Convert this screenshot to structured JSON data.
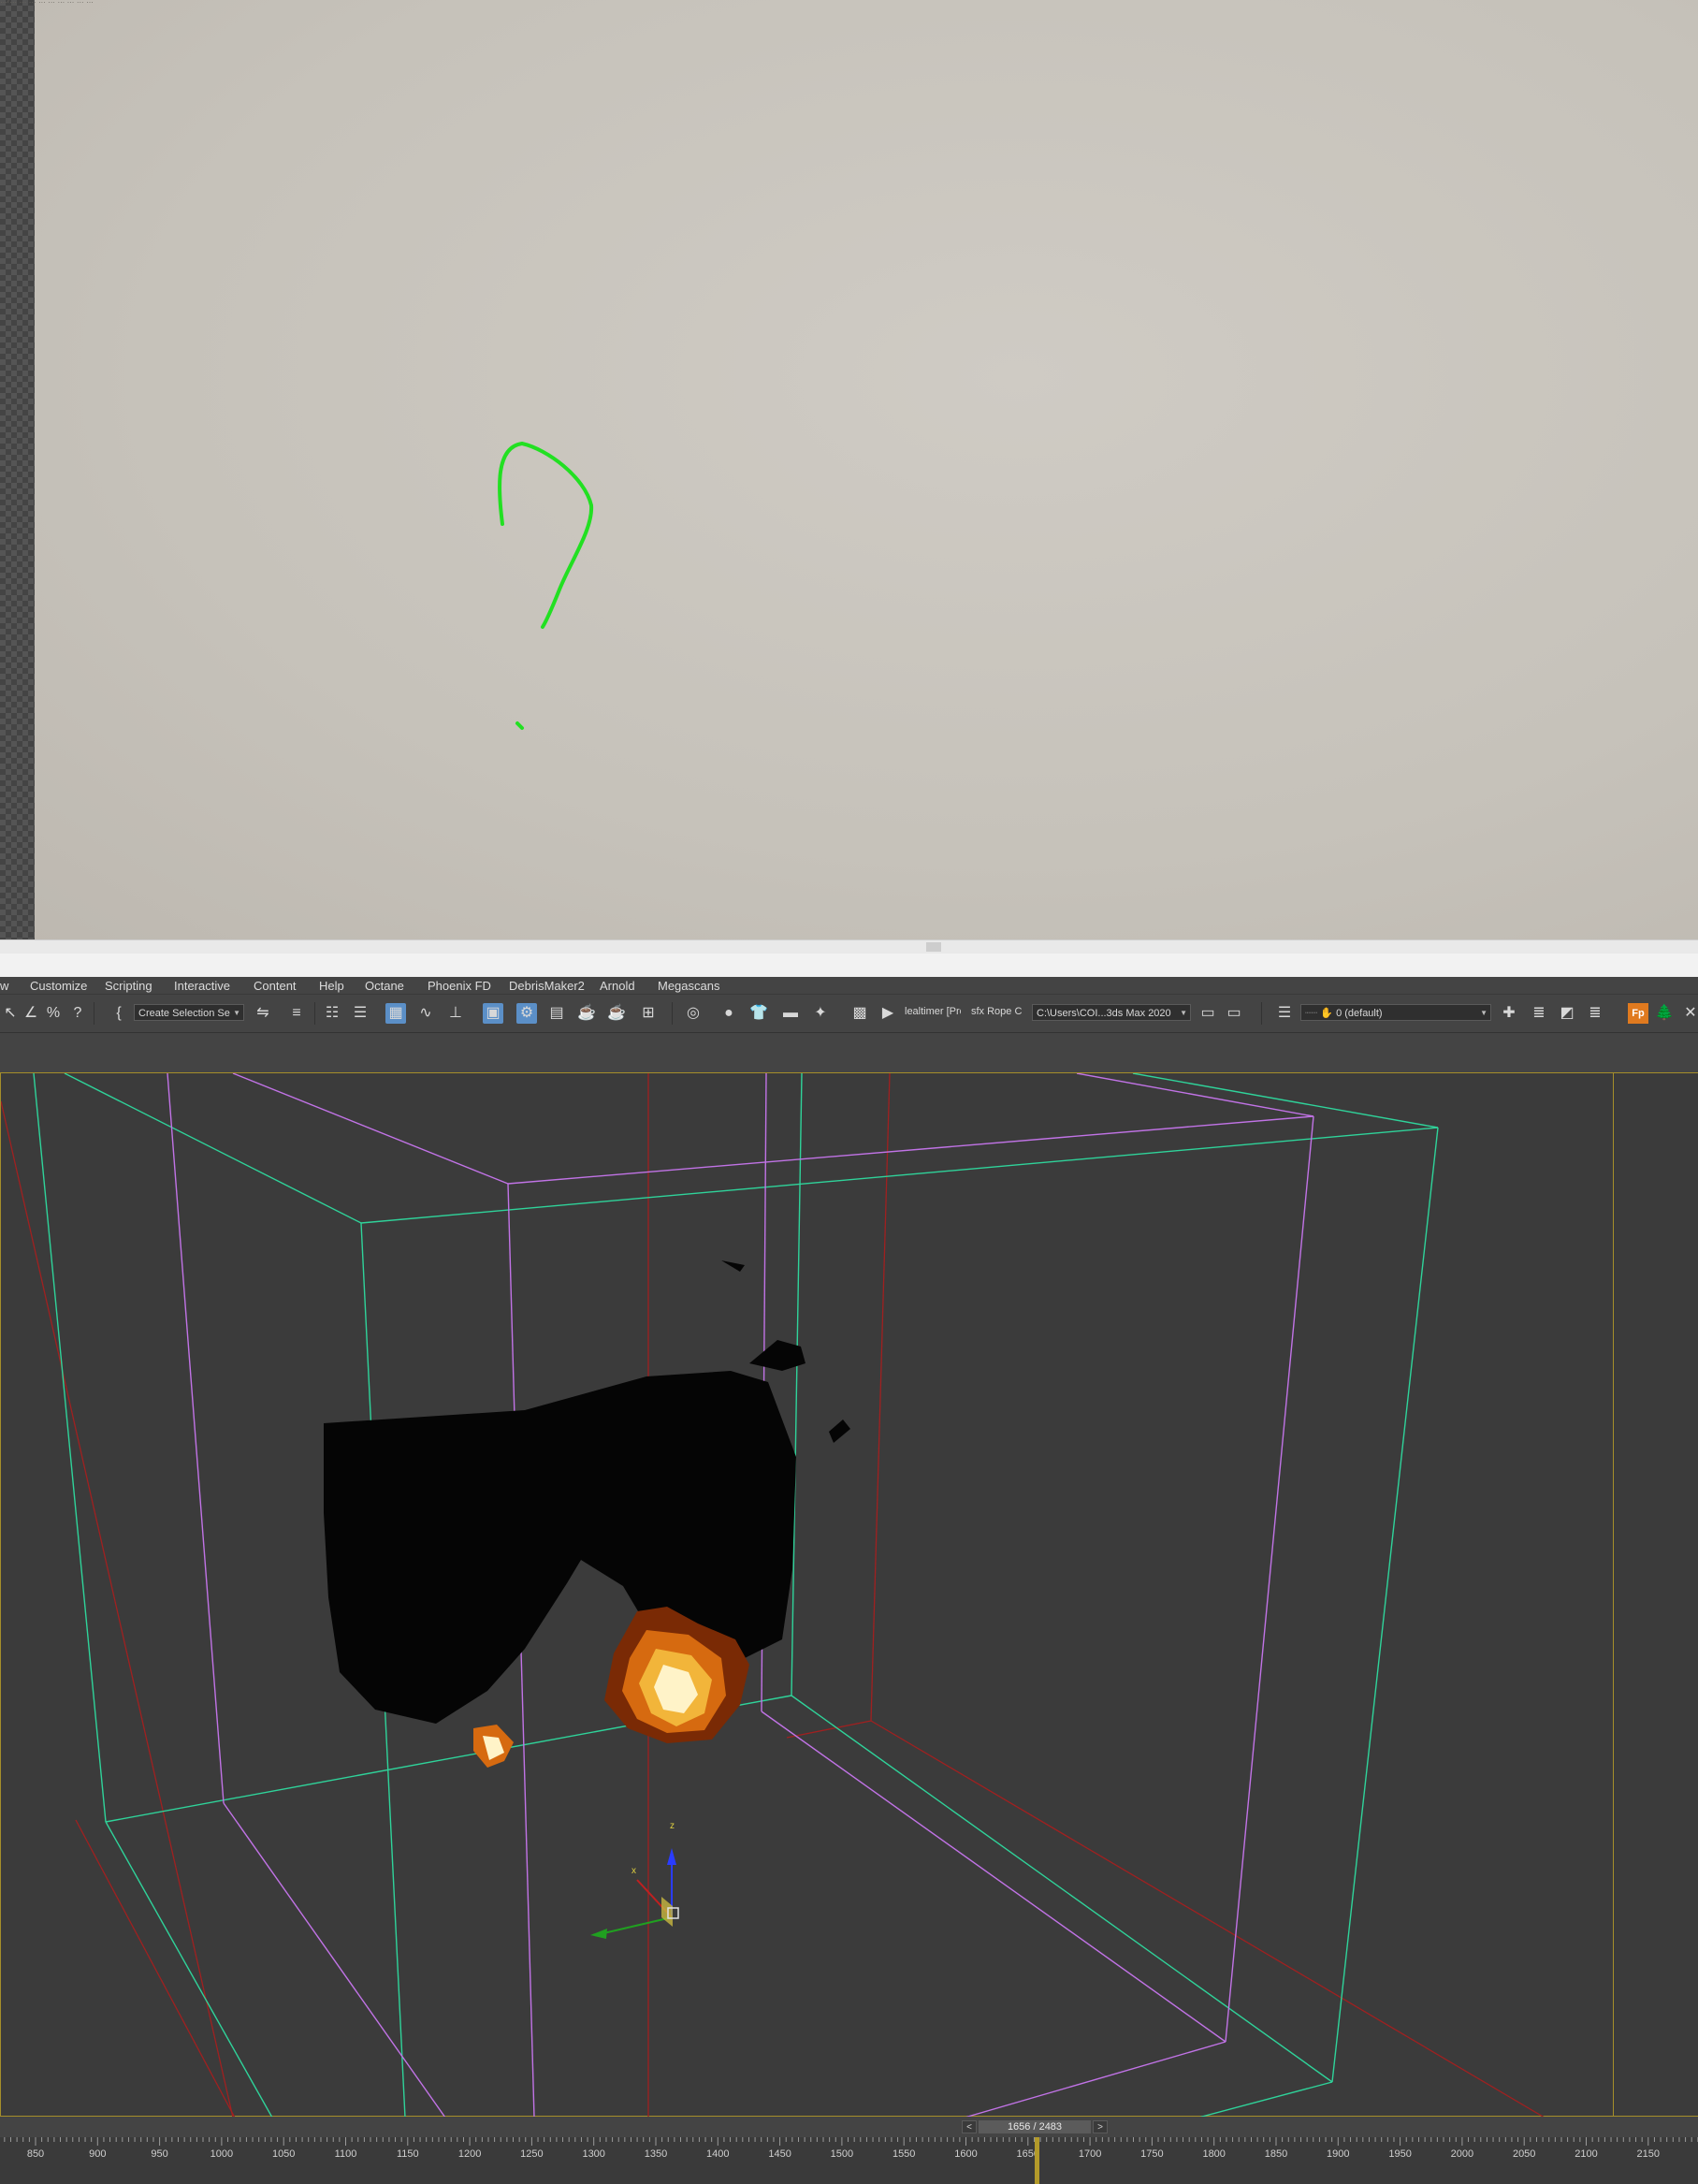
{
  "viewer": {
    "info_line": "…/…  …  …  …  …  …  …  …  …"
  },
  "menu": {
    "items": [
      {
        "id": "view",
        "label": "w"
      },
      {
        "id": "customize",
        "label": "Customize"
      },
      {
        "id": "scripting",
        "label": "Scripting"
      },
      {
        "id": "interactive",
        "label": "Interactive"
      },
      {
        "id": "content",
        "label": "Content"
      },
      {
        "id": "help",
        "label": "Help"
      },
      {
        "id": "octane",
        "label": "Octane"
      },
      {
        "id": "phoenix",
        "label": "Phoenix FD"
      },
      {
        "id": "debris",
        "label": "DebrisMaker2"
      },
      {
        "id": "arnold",
        "label": "Arnold"
      },
      {
        "id": "megascans",
        "label": "Megascans"
      }
    ]
  },
  "toolbar": {
    "selection_set": "Create Selection Se",
    "realtimer_text": "lealtimer [Pro",
    "rope_text": "sfx Rope C",
    "project_path": "C:\\Users\\COI...3ds Max 2020",
    "layer_name": "0 (default)",
    "fp_label": "Fp"
  },
  "timeslider": {
    "prev": "<",
    "next": ">",
    "readout": "1656 / 2483",
    "current_frame": 1656,
    "total_frames": 2483
  },
  "trackbar": {
    "labels": [
      "850",
      "900",
      "950",
      "1000",
      "1050",
      "1100",
      "1150",
      "1200",
      "1250",
      "1300",
      "1350",
      "1400",
      "1450",
      "1500",
      "1550",
      "1600",
      "1650",
      "1700",
      "1750",
      "1800",
      "1850",
      "1900",
      "1950",
      "2000",
      "2050",
      "2100",
      "2150"
    ]
  },
  "colors": {
    "annotation": "#22e022",
    "viewport_bg": "#3b3b3b",
    "box_green": "#2fd39a",
    "box_purple": "#c173e6",
    "box_red": "#a02020",
    "viewport_border": "#a58e2a"
  },
  "icons": [
    "select-object-icon",
    "select-by-name-icon",
    "snap-toggle-icon",
    "percent-snap-icon",
    "spinner-snap-icon",
    "edit-named-selection-icon",
    "mirror-icon",
    "align-icon",
    "scene-explorer-icon",
    "layer-explorer-icon",
    "render-setup-icon",
    "rendered-frame-window-icon",
    "render-icon",
    "material-editor-icon"
  ]
}
